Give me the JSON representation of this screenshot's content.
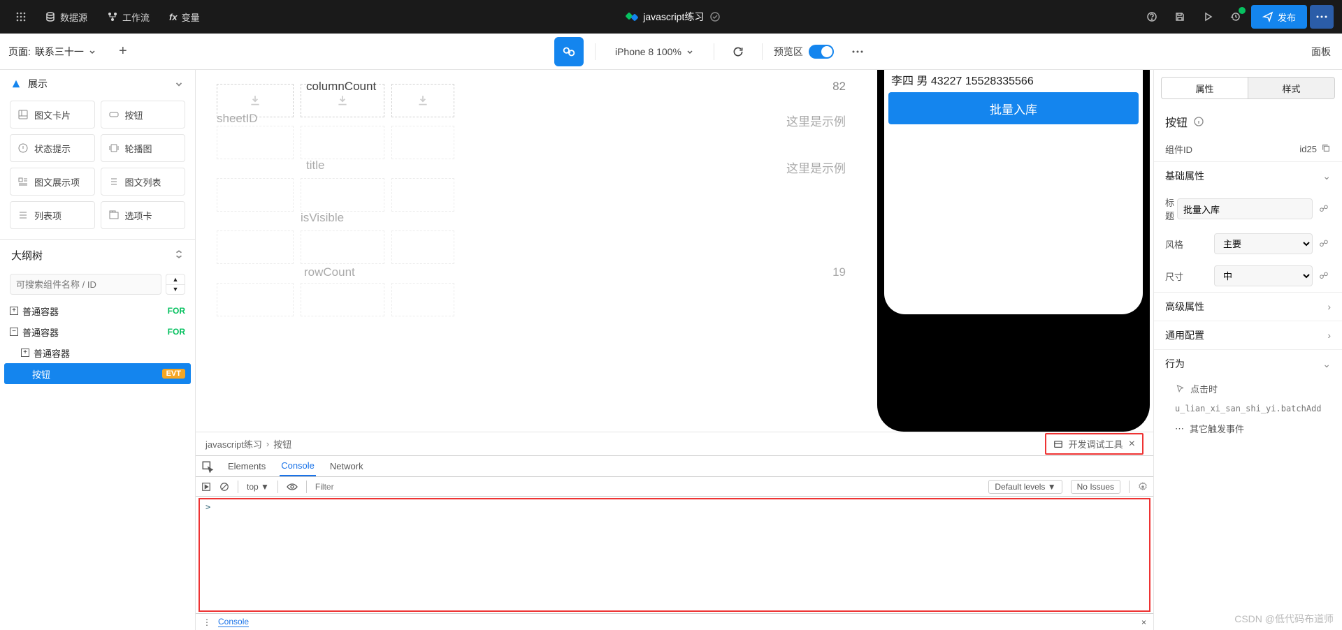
{
  "topbar": {
    "menu1": "数据源",
    "menu2": "工作流",
    "menu3": "变量",
    "project_title": "javascript练习",
    "publish": "发布"
  },
  "secondbar": {
    "page_prefix": "页面:",
    "page_name": "联系三十一",
    "device": "iPhone 8 100%",
    "preview_label": "预览区",
    "panel_label": "面板"
  },
  "display_section": {
    "title": "展示",
    "items": [
      "图文卡片",
      "按钮",
      "状态提示",
      "轮播图",
      "图文展示项",
      "图文列表",
      "列表项",
      "选项卡"
    ]
  },
  "outline": {
    "title": "大纲树",
    "search_placeholder": "可搜索组件名称 / ID",
    "nodes": [
      {
        "label": "普通容器",
        "badge": "FOR",
        "icon": "plus",
        "indent": 0
      },
      {
        "label": "普通容器",
        "badge": "FOR",
        "icon": "minus",
        "indent": 0
      },
      {
        "label": "普通容器",
        "badge": "",
        "icon": "plus",
        "indent": 1
      },
      {
        "label": "按钮",
        "badge": "EVT",
        "icon": "",
        "indent": 2,
        "selected": true
      }
    ]
  },
  "canvas_rows": [
    {
      "label": "columnCount",
      "value": "82"
    },
    {
      "label": "sheetID",
      "value": "这里是示例"
    },
    {
      "label": "title",
      "value": "这里是示例"
    },
    {
      "label": "isVisible",
      "value": ""
    },
    {
      "label": "rowCount",
      "value": "19"
    }
  ],
  "phone": {
    "text_line": "李四 男 43227 15528335566",
    "button_label": "批量入库"
  },
  "breadcrumb": {
    "a": "javascript练习",
    "b": "按钮",
    "devtool_label": "开发调试工具"
  },
  "devtools": {
    "tabs": [
      "Elements",
      "Console",
      "Network"
    ],
    "context": "top",
    "filter_placeholder": "Filter",
    "default_levels": "Default levels",
    "no_issues": "No Issues",
    "footer": "Console"
  },
  "right": {
    "tabs": [
      "属性",
      "样式"
    ],
    "title": "按钮",
    "id_label": "组件ID",
    "id_value": "id25",
    "blocks": {
      "basic": "基础属性",
      "title_label": "标题",
      "title_value": "批量入库",
      "style_label": "风格",
      "style_value": "主要",
      "size_label": "尺寸",
      "size_value": "中",
      "advanced": "高级属性",
      "general": "通用配置",
      "behavior": "行为",
      "on_click": "点击时",
      "handler": "u_lian_xi_san_shi_yi.batchAdd",
      "others": "其它触发事件"
    }
  },
  "watermark": "CSDN @低代码布道师"
}
